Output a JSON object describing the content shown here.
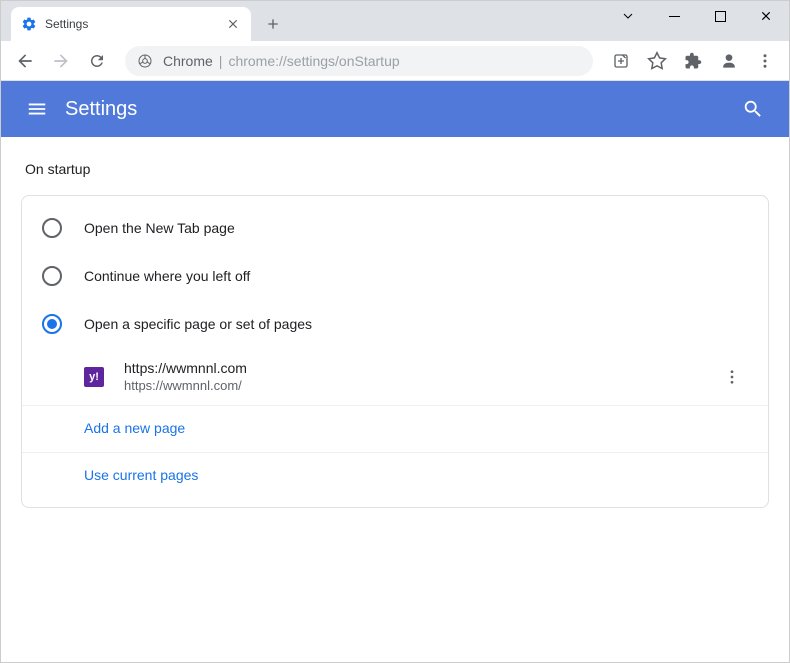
{
  "tab": {
    "title": "Settings"
  },
  "omnibox": {
    "origin": "Chrome",
    "path": "chrome://settings/onStartup"
  },
  "header": {
    "title": "Settings"
  },
  "section": {
    "title": "On startup"
  },
  "options": {
    "new_tab": "Open the New Tab page",
    "continue": "Continue where you left off",
    "specific": "Open a specific page or set of pages"
  },
  "page": {
    "favicon_letter": "y!",
    "title": "https://wwmnnl.com",
    "url": "https://wwmnnl.com/"
  },
  "actions": {
    "add_page": "Add a new page",
    "use_current": "Use current pages"
  }
}
